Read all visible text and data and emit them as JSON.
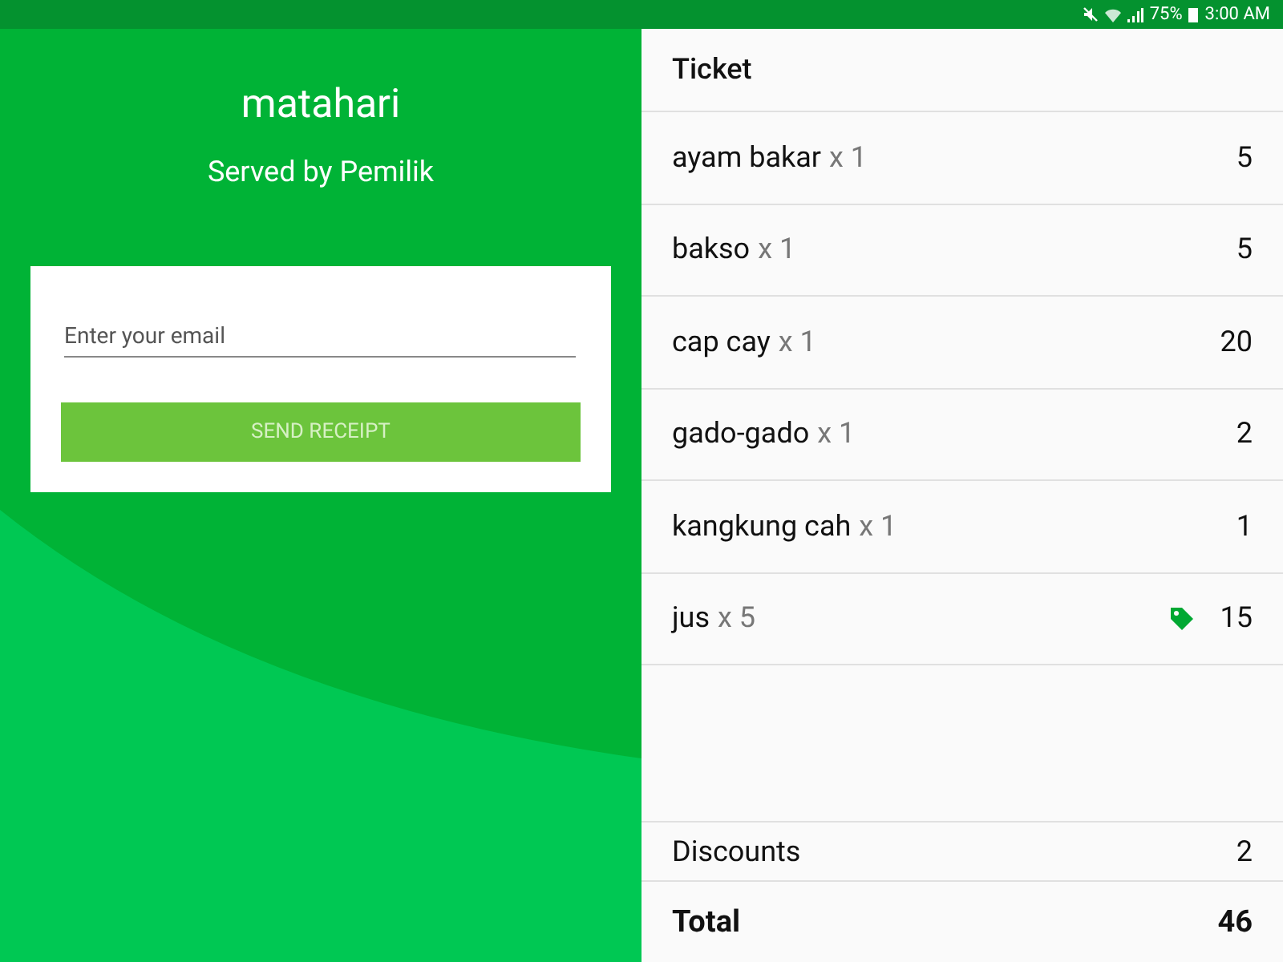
{
  "status_bar": {
    "battery": "75%",
    "time": "3:00 AM"
  },
  "store": {
    "name": "matahari",
    "served_by": "Served by Pemilik"
  },
  "receipt_form": {
    "placeholder": "Enter your email",
    "button": "SEND RECEIPT"
  },
  "ticket": {
    "title": "Ticket",
    "items": [
      {
        "name": "ayam bakar",
        "qty": "x 1",
        "price": "5",
        "discounted": false
      },
      {
        "name": "bakso",
        "qty": "x 1",
        "price": "5",
        "discounted": false
      },
      {
        "name": "cap cay",
        "qty": "x 1",
        "price": "20",
        "discounted": false
      },
      {
        "name": "gado-gado",
        "qty": "x 1",
        "price": "2",
        "discounted": false
      },
      {
        "name": "kangkung cah",
        "qty": "x 1",
        "price": "1",
        "discounted": false
      },
      {
        "name": "jus",
        "qty": "x 5",
        "price": "15",
        "discounted": true
      }
    ],
    "discounts": {
      "label": "Discounts",
      "value": "2"
    },
    "total": {
      "label": "Total",
      "value": "46"
    }
  }
}
